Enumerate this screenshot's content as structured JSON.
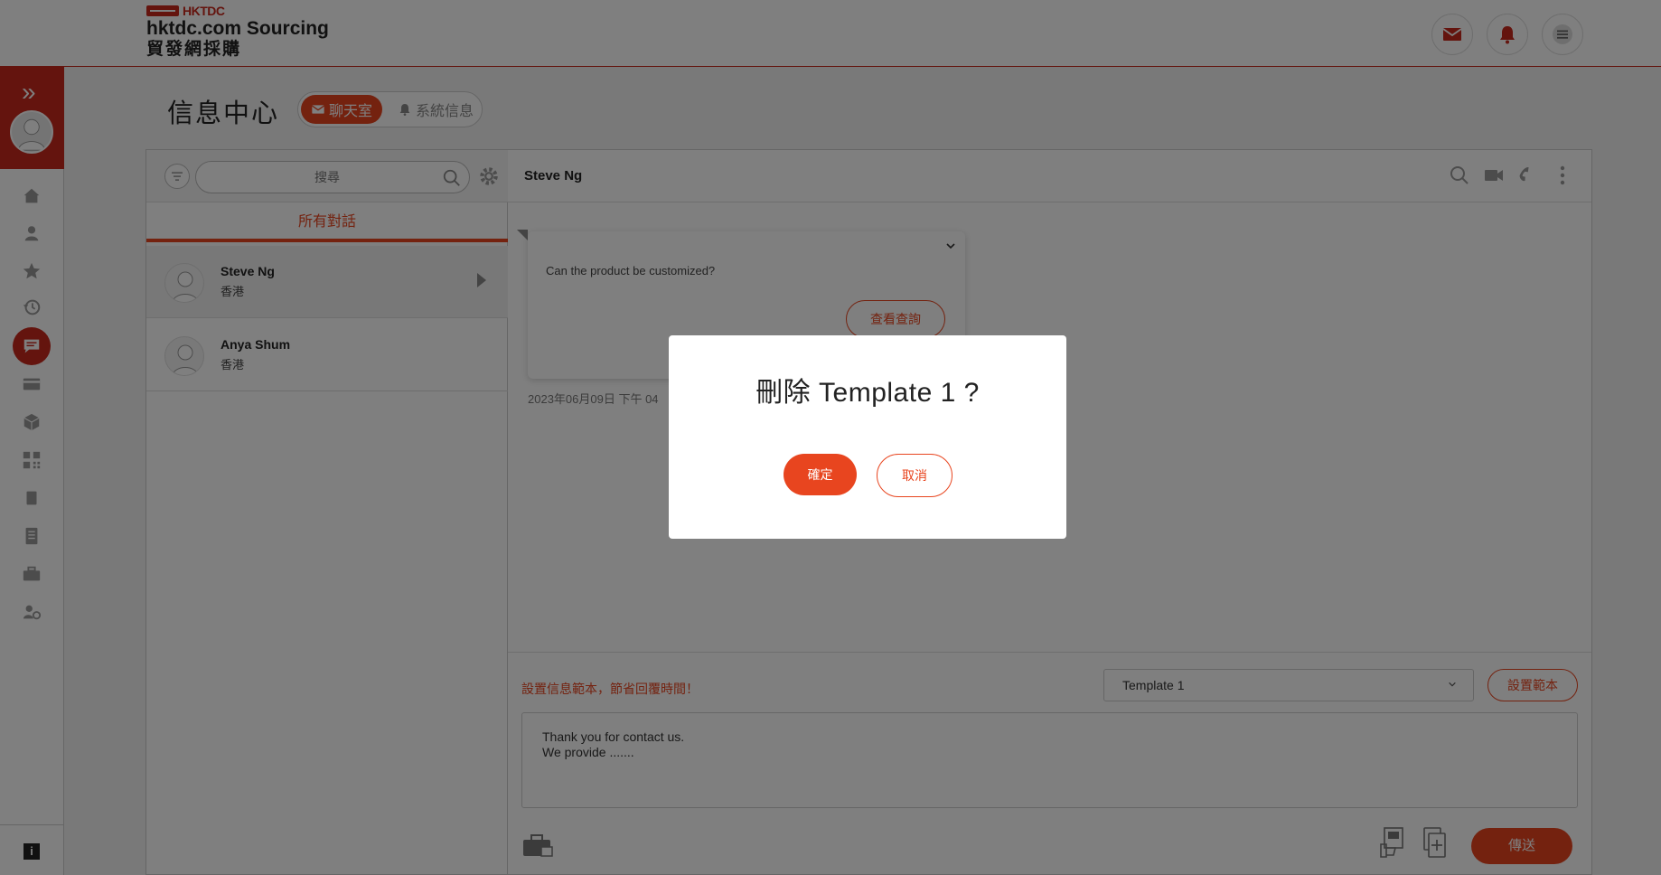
{
  "header": {
    "logo_top": "HKTDC",
    "logo_en": "hktdc.com Sourcing",
    "logo_zh": "貿發網採購",
    "icons": [
      "mail-icon",
      "bell-icon",
      "menu-icon"
    ]
  },
  "colors": {
    "brand": "#c8281c",
    "accent": "#e8451f"
  },
  "sidebar": {
    "items": [
      "home-icon",
      "user-icon",
      "star-icon",
      "history-icon",
      "chat-icon",
      "card-icon",
      "box-icon",
      "qr-icon",
      "bookmark-icon",
      "document-icon",
      "briefcase-icon",
      "settings-user-icon"
    ],
    "active": "chat-icon",
    "info_label": "i"
  },
  "page": {
    "title": "信息中心",
    "tabs": [
      {
        "label": "聊天室",
        "active": true
      },
      {
        "label": "系統信息",
        "active": false
      }
    ]
  },
  "conversations": {
    "search_placeholder": "搜尋",
    "filter_tab": "所有對話",
    "items": [
      {
        "name": "Steve Ng",
        "location": "香港",
        "selected": true
      },
      {
        "name": "Anya Shum",
        "location": "香港",
        "selected": false
      }
    ]
  },
  "chat": {
    "contact_name": "Steve Ng",
    "message": {
      "text": "Can the product be customized?",
      "button": "查看查詢",
      "timestamp": "2023年06月09日 下午 04"
    },
    "compose": {
      "hint": "設置信息範本，節省回覆時間！",
      "template_selected": "Template 1",
      "template_button": "設置範本",
      "text": "Thank you for contact us.\nWe provide .......",
      "send_label": "傳送"
    }
  },
  "modal": {
    "title": "刪除 Template 1 ?",
    "confirm_label": "確定",
    "cancel_label": "取消"
  }
}
